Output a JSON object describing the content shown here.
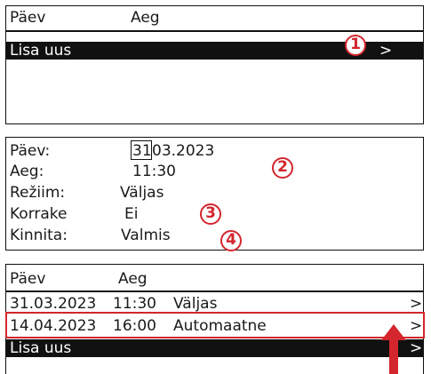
{
  "panel1": {
    "header": {
      "col_day": "Päev",
      "col_time": "Aeg"
    },
    "add_new_label": "Lisa uus",
    "chevron": ">"
  },
  "panel2": {
    "fields": [
      {
        "label": "Päev:",
        "value_cursor": "31",
        "value_rest": "03.2023"
      },
      {
        "label": "Aeg:",
        "value": "11:30"
      },
      {
        "label": "Režiim:",
        "value": "Väljas"
      },
      {
        "label": "Korrake",
        "value": "Ei"
      },
      {
        "label": "Kinnita:",
        "value": "Valmis"
      }
    ]
  },
  "panel3": {
    "header": {
      "col_day": "Päev",
      "col_time": "Aeg"
    },
    "rows": [
      {
        "date": "31.03.2023",
        "time": "11:30",
        "mode": "Väljas",
        "chevron": ">"
      },
      {
        "date": "14.04.2023",
        "time": "16:00",
        "mode": "Automaatne",
        "chevron": ">"
      }
    ],
    "add_new_label": "Lisa uus",
    "chevron": ">"
  },
  "callouts": [
    "1",
    "2",
    "3",
    "4"
  ],
  "colors": {
    "accent": "#d3262d",
    "selection": "#111111",
    "text": "#1a1a1a"
  }
}
